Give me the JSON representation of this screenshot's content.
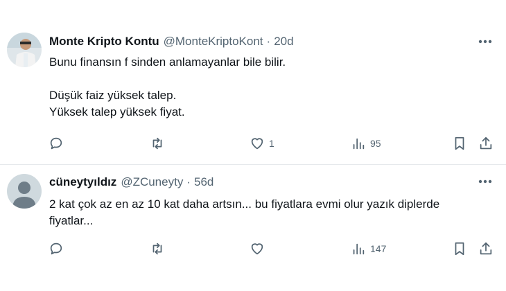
{
  "tweets": [
    {
      "name": "Monte Kripto Kontu",
      "handle": "@MonteKriptoKont",
      "separator": "·",
      "time": "20d",
      "lines": [
        "Bunu finansın f sinden anlamayanlar bile bilir.",
        "",
        "Düşük faiz yüksek talep.",
        "Yüksek talep yüksek fiyat."
      ],
      "likes": "1",
      "views": "95",
      "avatar": "photo"
    },
    {
      "name": "cüneytyıldız",
      "handle": "@ZCuneyty",
      "separator": "·",
      "time": "56d",
      "lines": [
        "2 kat çok az en az 10 kat daha artsın... bu fiyatlara evmi olur yazık diplerde",
        "fiyatlar..."
      ],
      "likes": "",
      "views": "147",
      "avatar": "default-avatar"
    }
  ],
  "icons": [
    "more-icon",
    "reply-icon",
    "retweet-icon",
    "like-icon",
    "views-icon",
    "bookmark-icon",
    "share-icon"
  ],
  "colors": {
    "text": "#0f1419",
    "secondary": "#536471",
    "divider": "#e6e9ec"
  }
}
